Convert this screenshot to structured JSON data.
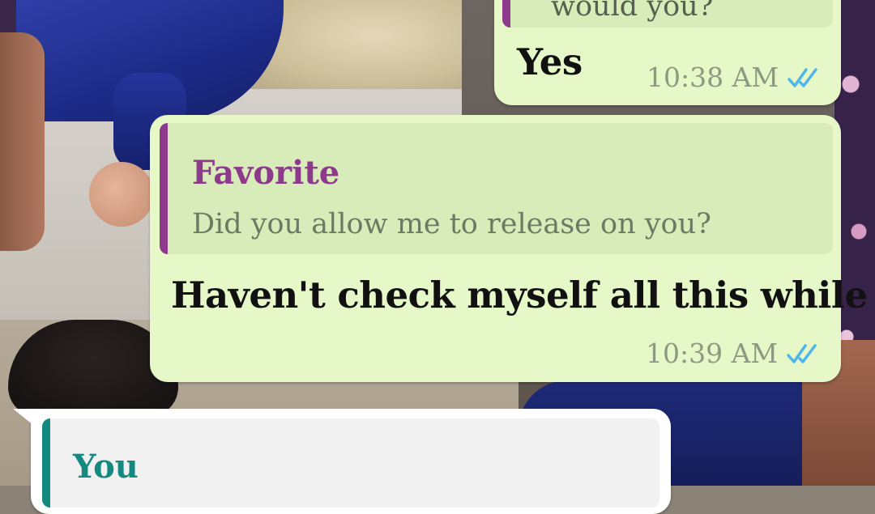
{
  "colors": {
    "outgoing_bubble": "#e6f8c8",
    "incoming_bubble": "#ffffff",
    "quote_bar_favorite": "#8e3a8c",
    "quote_bar_you": "#13897f",
    "quote_author_favorite": "#8e3a8c",
    "quote_author_you": "#13897f",
    "read_ticks": "#4fb5ea",
    "timestamp": "#8c9a82"
  },
  "messages": [
    {
      "direction": "outgoing",
      "quote_text_partial": "would you?",
      "text": "Yes",
      "time": "10:38 AM",
      "status_icon": "double-check-read-icon"
    },
    {
      "direction": "outgoing",
      "quote_author": "Favorite",
      "quote_text": "Did you allow me to release on you?",
      "text": "Haven't check myself all this while",
      "time": "10:39 AM",
      "status_icon": "double-check-read-icon"
    },
    {
      "direction": "incoming",
      "quote_author": "You"
    }
  ]
}
